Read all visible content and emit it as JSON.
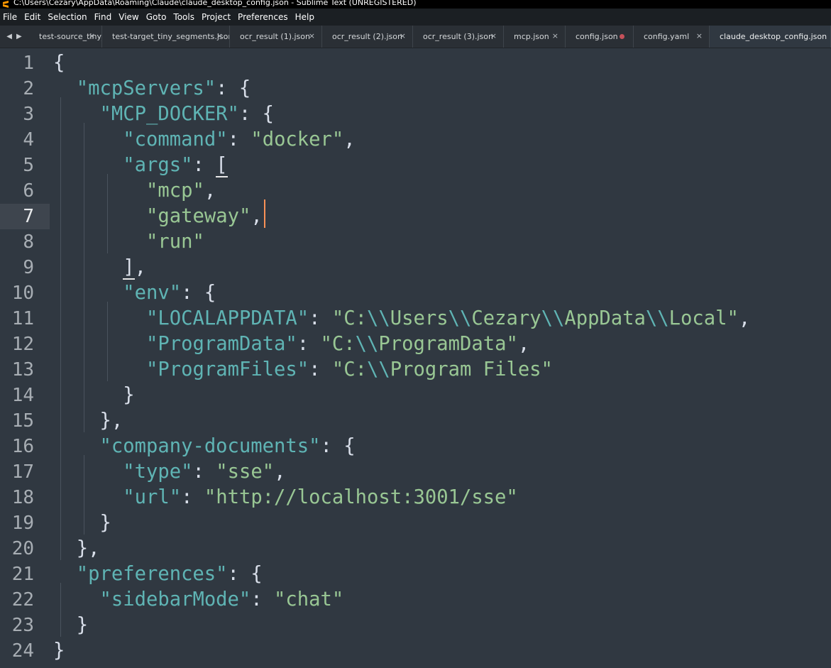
{
  "window": {
    "title": "C:\\Users\\Cezary\\AppData\\Roaming\\Claude\\claude_desktop_config.json - Sublime Text (UNREGISTERED)",
    "app_icon": "sublime-icon"
  },
  "menu": [
    "File",
    "Edit",
    "Selection",
    "Find",
    "View",
    "Goto",
    "Tools",
    "Project",
    "Preferences",
    "Help"
  ],
  "tabs": [
    {
      "label": "test-source_tiny_se",
      "close": "×",
      "state": "clean"
    },
    {
      "label": "test-target_tiny_segments.json",
      "close": "×",
      "state": "clean"
    },
    {
      "label": "ocr_result (1).json",
      "close": "×",
      "state": "clean"
    },
    {
      "label": "ocr_result (2).json",
      "close": "×",
      "state": "clean"
    },
    {
      "label": "ocr_result (3).json",
      "close": "×",
      "state": "clean"
    },
    {
      "label": "mcp.json",
      "close": "×",
      "state": "clean"
    },
    {
      "label": "config.json",
      "close": "",
      "state": "dirty"
    },
    {
      "label": "config.yaml",
      "close": "×",
      "state": "clean"
    },
    {
      "label": "claude_desktop_config.json",
      "close": "",
      "state": "active"
    }
  ],
  "nav": {
    "left": "◀",
    "right": "▶"
  },
  "editor": {
    "current_line": 7,
    "line_numbers": [
      "1",
      "2",
      "3",
      "4",
      "5",
      "6",
      "7",
      "8",
      "9",
      "10",
      "11",
      "12",
      "13",
      "14",
      "15",
      "16",
      "17",
      "18",
      "19",
      "20",
      "21",
      "22",
      "23",
      "24"
    ],
    "lines": [
      "{",
      "  \"mcpServers\": {",
      "    \"MCP_DOCKER\": {",
      "      \"command\": \"docker\",",
      "      \"args\": [",
      "        \"mcp\",",
      "        \"gateway\",",
      "        \"run\"",
      "      ],",
      "      \"env\": {",
      "        \"LOCALAPPDATA\": \"C:\\\\Users\\\\Cezary\\\\AppData\\\\Local\",",
      "        \"ProgramData\": \"C:\\\\ProgramData\",",
      "        \"ProgramFiles\": \"C:\\\\Program Files\"",
      "      }",
      "    },",
      "    \"company-documents\": {",
      "      \"type\": \"sse\",",
      "      \"url\": \"http://localhost:3001/sse\"",
      "    }",
      "  },",
      "  \"preferences\": {",
      "    \"sidebarMode\": \"chat\"",
      "  }",
      "}"
    ]
  },
  "colors": {
    "background": "#303841",
    "key": "#5fb4b4",
    "string": "#99c794",
    "punctuation": "#d8dee9",
    "cursor": "#f99157",
    "line_highlight": "#3e454e"
  }
}
